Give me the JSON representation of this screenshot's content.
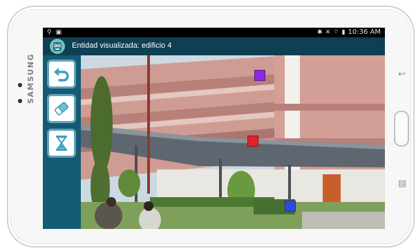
{
  "device": {
    "brand": "SAMSUNG"
  },
  "status_bar": {
    "time": "10:36 AM"
  },
  "app": {
    "title": "Entidad visualizada: edificio 4"
  },
  "toolbar": [
    {
      "icon": "undo-arrow-icon"
    },
    {
      "icon": "eraser-icon"
    },
    {
      "icon": "hourglass-icon"
    }
  ],
  "markers": [
    {
      "color": "#8a2be2",
      "shape": "cube"
    },
    {
      "color": "#e0242a",
      "shape": "cube"
    },
    {
      "color": "#2b4be0",
      "shape": "cube"
    }
  ],
  "colors": {
    "title_bar": "#0e3f52",
    "sidebar": "#155a73",
    "button_border": "#5fa3b9"
  }
}
